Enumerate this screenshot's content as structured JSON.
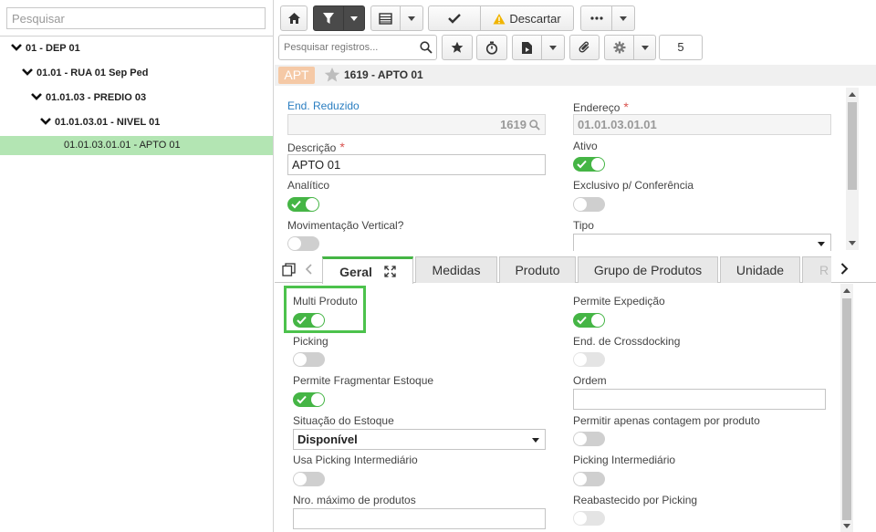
{
  "left_panel": {
    "search_placeholder": "Pesquisar",
    "tree": [
      {
        "label": "01 - DEP 01"
      },
      {
        "label": "01.01 - RUA 01 Sep Ped"
      },
      {
        "label": "01.01.03 - PREDIO 03"
      },
      {
        "label": "01.01.03.01 - NIVEL 01"
      },
      {
        "label": "01.01.03.01.01 - APTO 01"
      }
    ]
  },
  "toolbar": {
    "discard_label": "Descartar",
    "search_placeholder": "Pesquisar registros...",
    "page_number": "5"
  },
  "record": {
    "badge": "APT",
    "title": "1619 - APTO 01"
  },
  "form": {
    "end_reduzido_label": "End. Reduzido",
    "end_reduzido_value": "1619",
    "endereco_label": "Endereço",
    "endereco_value": "01.01.03.01.01",
    "descricao_label": "Descrição",
    "descricao_value": "APTO 01",
    "ativo_label": "Ativo",
    "analitico_label": "Analítico",
    "exclusivo_label": "Exclusivo p/ Conferência",
    "mov_vertical_label": "Movimentação Vertical?",
    "tipo_label": "Tipo",
    "tipo_value": ""
  },
  "tabs": [
    {
      "label": "Geral"
    },
    {
      "label": "Medidas"
    },
    {
      "label": "Produto"
    },
    {
      "label": "Grupo de Produtos"
    },
    {
      "label": "Unidade"
    },
    {
      "label": "R"
    }
  ],
  "geral": {
    "multi_produto": "Multi Produto",
    "permite_expedicao": "Permite Expedição",
    "picking": "Picking",
    "end_crossdocking": "End. de Crossdocking",
    "permite_fragmentar": "Permite Fragmentar Estoque",
    "ordem": "Ordem",
    "ordem_value": "",
    "situacao_estoque": "Situação do Estoque",
    "situacao_value": "Disponível",
    "permitir_contagem": "Permitir apenas contagem por produto",
    "usa_picking_intermediario": "Usa Picking Intermediário",
    "picking_intermediario": "Picking Intermediário",
    "nro_max_produtos": "Nro. máximo de produtos",
    "nro_max_value": "",
    "reabastecido_picking": "Reabastecido por Picking"
  },
  "colors": {
    "accent_green": "#45b545",
    "selected_row": "#b3e5b3",
    "label_blue": "#2a7ec1",
    "required_red": "#d9534f"
  }
}
